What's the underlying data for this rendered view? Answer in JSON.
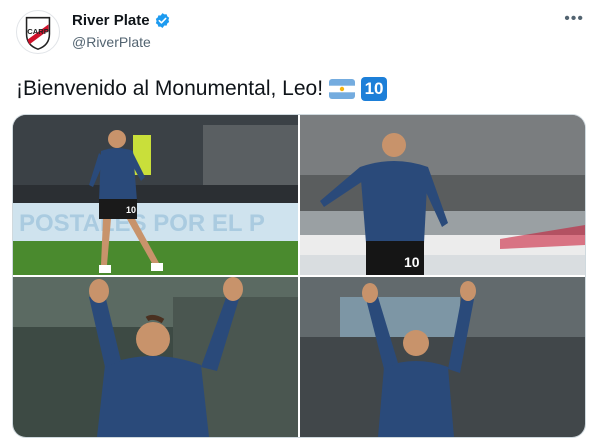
{
  "account": {
    "display_name": "River Plate",
    "handle": "@RiverPlate",
    "avatar_icon": "river-plate-crest-icon",
    "verified_icon": "verified-badge-icon",
    "verified_color": "#1d9bf0"
  },
  "menu": {
    "more_label": "•••"
  },
  "tweet": {
    "text": "¡Bienvenido al Monumental, Leo!",
    "emojis": [
      "argentina-flag-icon",
      "keycap-ten-icon"
    ],
    "ten_label": "10"
  },
  "photos": {
    "count": 4,
    "items": [
      {
        "name": "photo-warmup-jog",
        "shirt_number": "10",
        "banner_text": "POSTALES POR EL P"
      },
      {
        "name": "photo-warmup-stretch",
        "shirt_number": "10"
      },
      {
        "name": "photo-arms-raised-left"
      },
      {
        "name": "photo-arms-raised-right"
      }
    ]
  },
  "colors": {
    "text": "#0f1419",
    "secondary": "#536471",
    "pitch": "#4a8a2e",
    "jersey": "#2a4a7a"
  }
}
